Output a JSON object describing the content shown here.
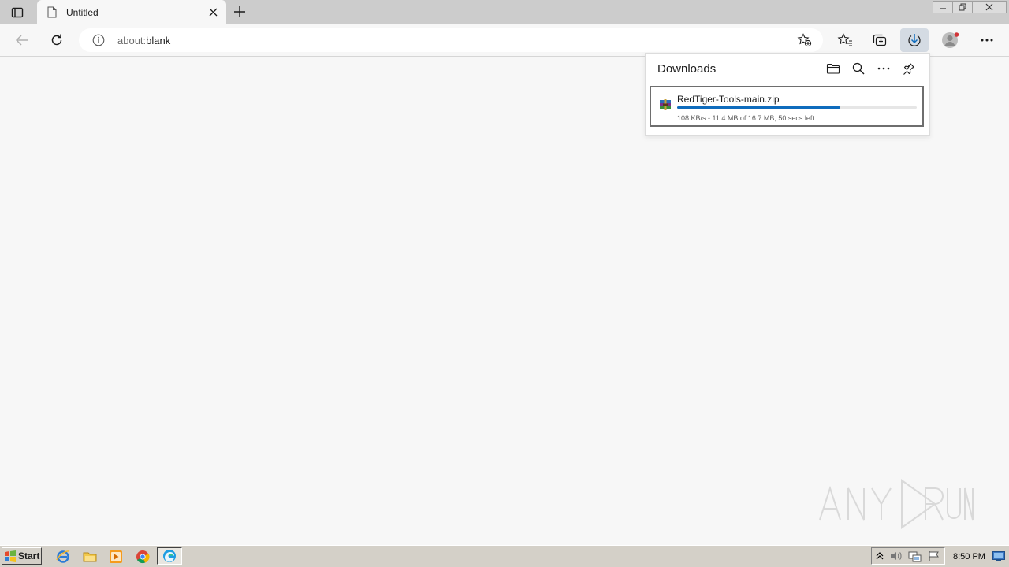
{
  "browser": {
    "tab": {
      "title": "Untitled"
    },
    "address_bar": {
      "scheme": "about:",
      "rest": "blank"
    }
  },
  "downloads_panel": {
    "title": "Downloads",
    "item": {
      "filename": "RedTiger-Tools-main.zip",
      "status": "108 KB/s - 11.4 MB of 16.7 MB, 50 secs left",
      "progress_fraction": 0.68
    }
  },
  "watermark": {
    "text": "ANY RUN"
  },
  "taskbar": {
    "start_label": "Start",
    "clock": "8:50 PM"
  },
  "colors": {
    "accent": "#0f6cbd",
    "downloads_button_active": "#d4dbe3",
    "profile_badge": "#d13438"
  }
}
